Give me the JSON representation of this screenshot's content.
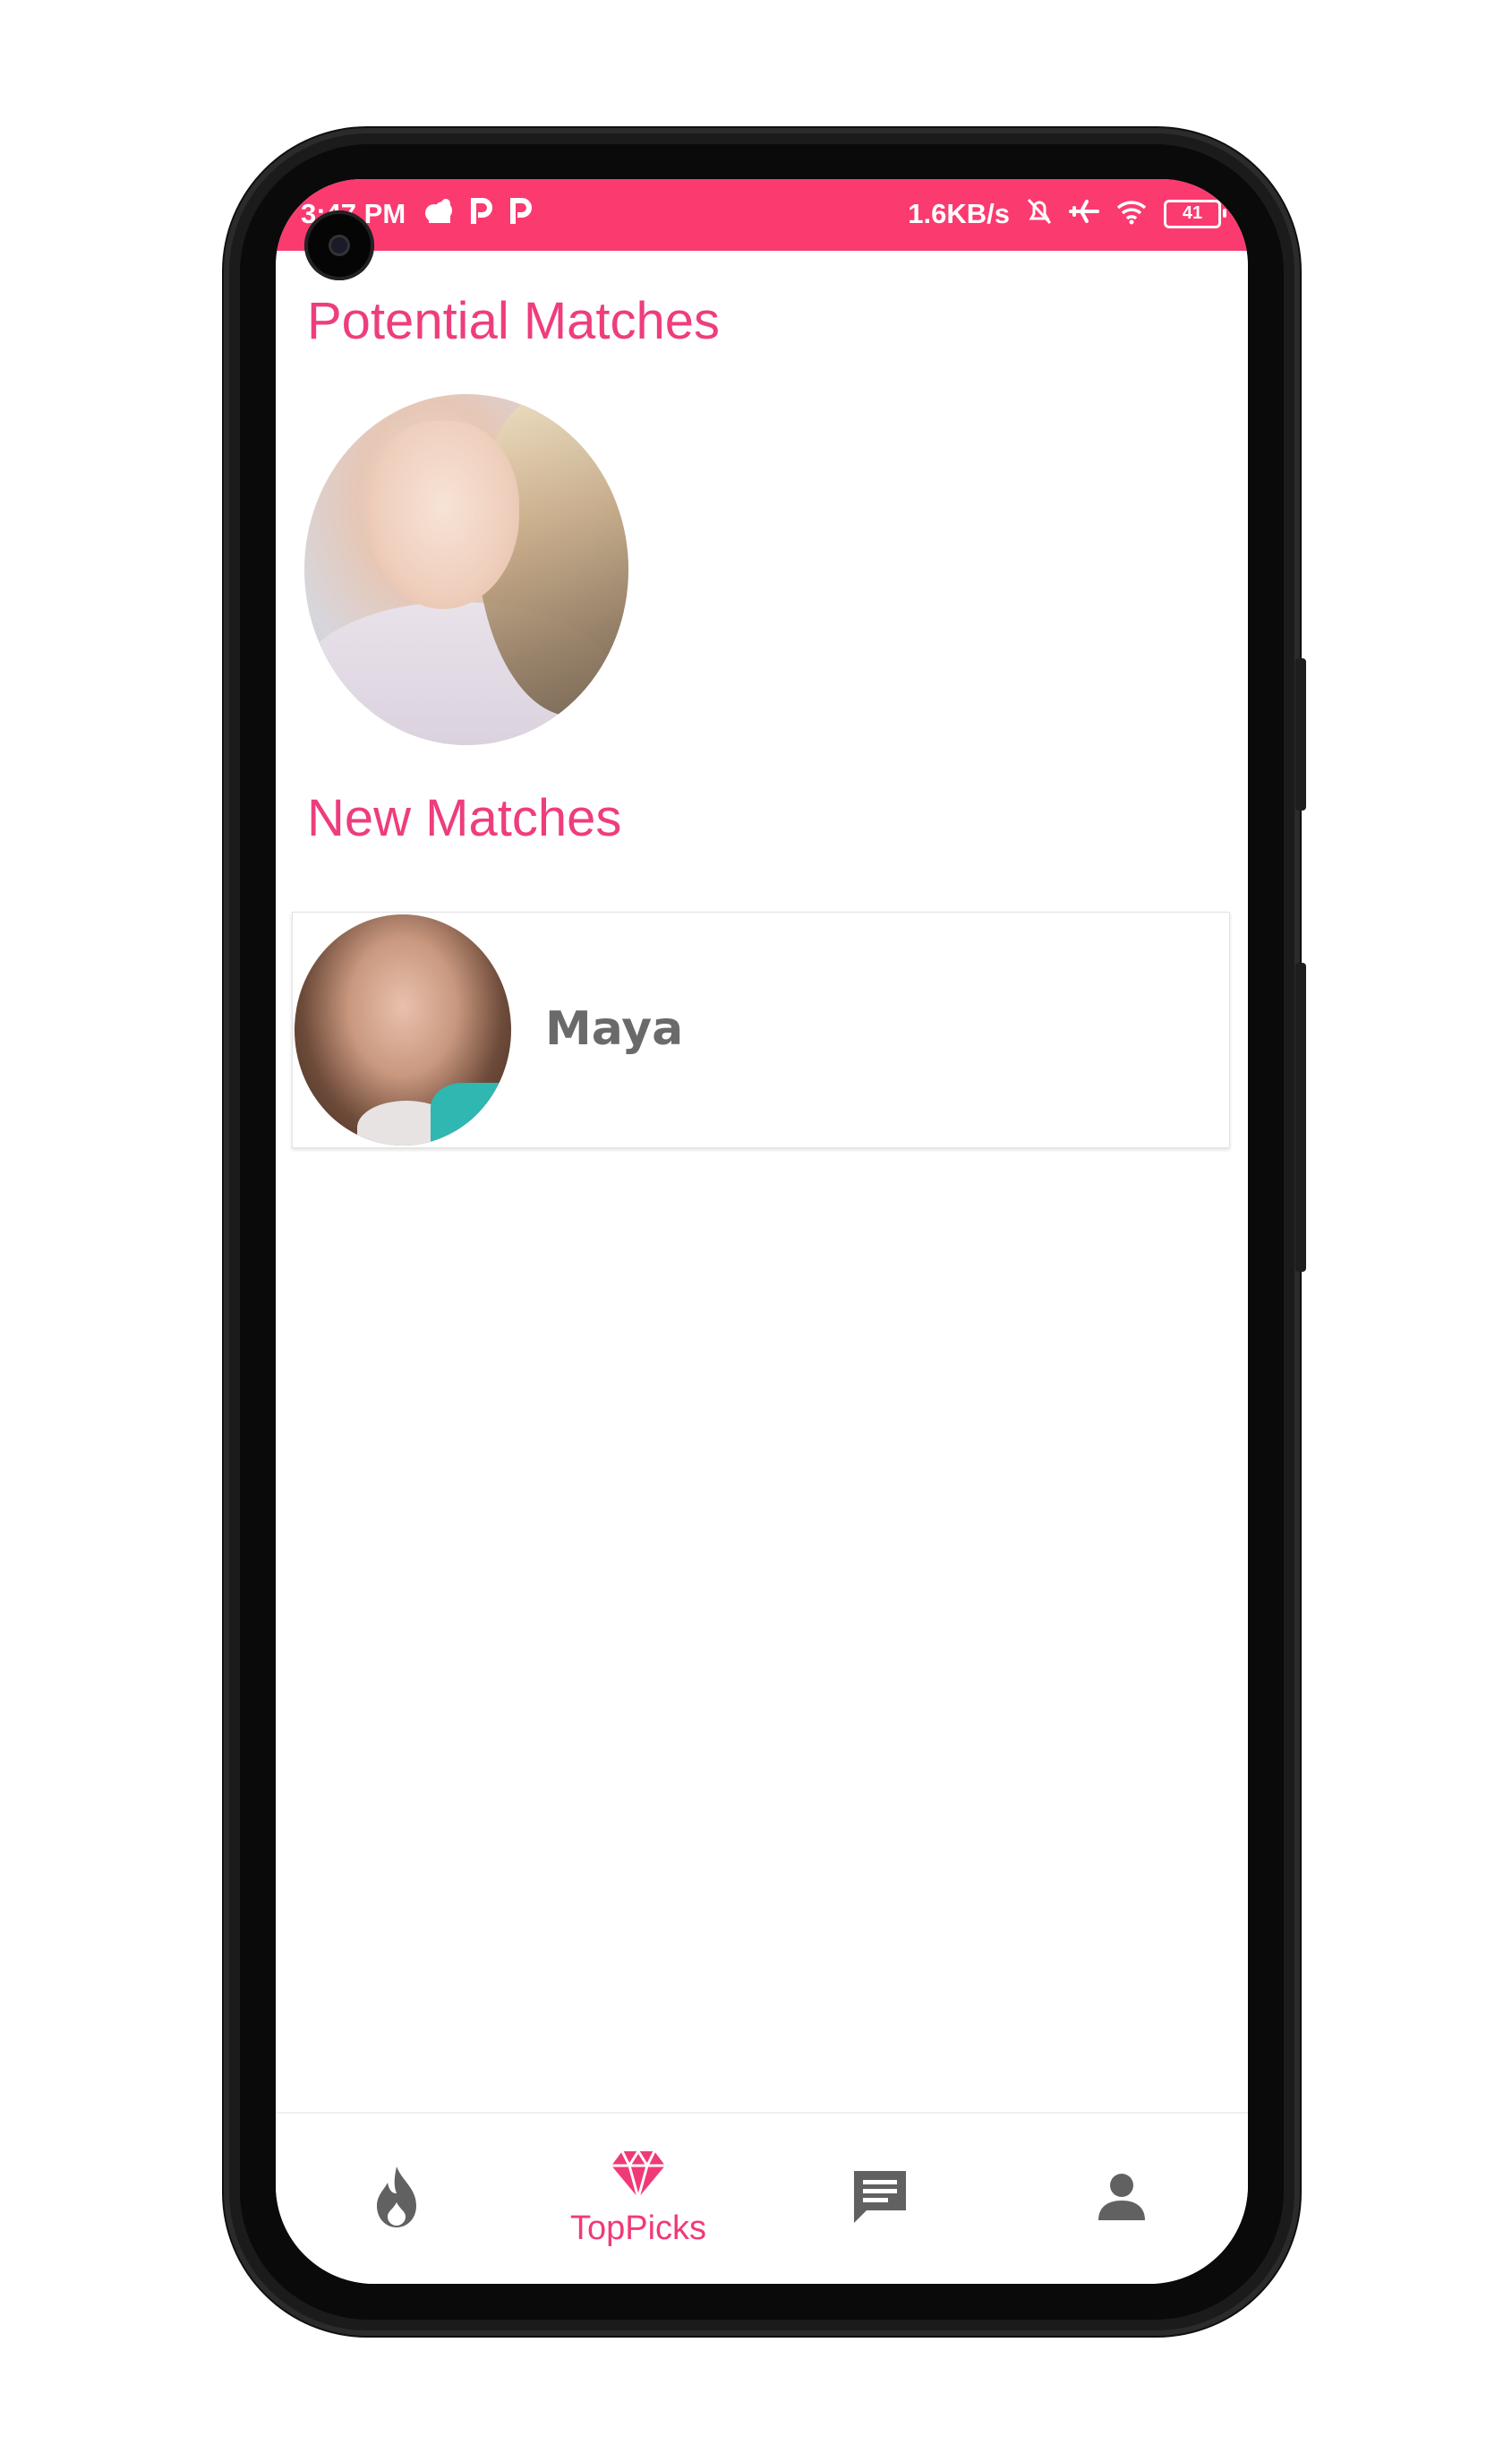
{
  "status_bar": {
    "time": "3:47 PM",
    "network_speed": "1.6KB/s",
    "battery_level": "41"
  },
  "sections": {
    "potential_title": "Potential Matches",
    "new_title": "New Matches"
  },
  "new_matches": [
    {
      "name": "Maya"
    }
  ],
  "bottom_nav": {
    "items": [
      {
        "icon": "flame-icon",
        "label": ""
      },
      {
        "icon": "diamond-icon",
        "label": "TopPicks",
        "active": true
      },
      {
        "icon": "chat-icon",
        "label": ""
      },
      {
        "icon": "profile-icon",
        "label": ""
      }
    ]
  },
  "colors": {
    "accent": "#fb3a70",
    "title_pink": "#ee3d7d",
    "icon_gray": "#616161",
    "name_gray": "#6a6a6a"
  }
}
